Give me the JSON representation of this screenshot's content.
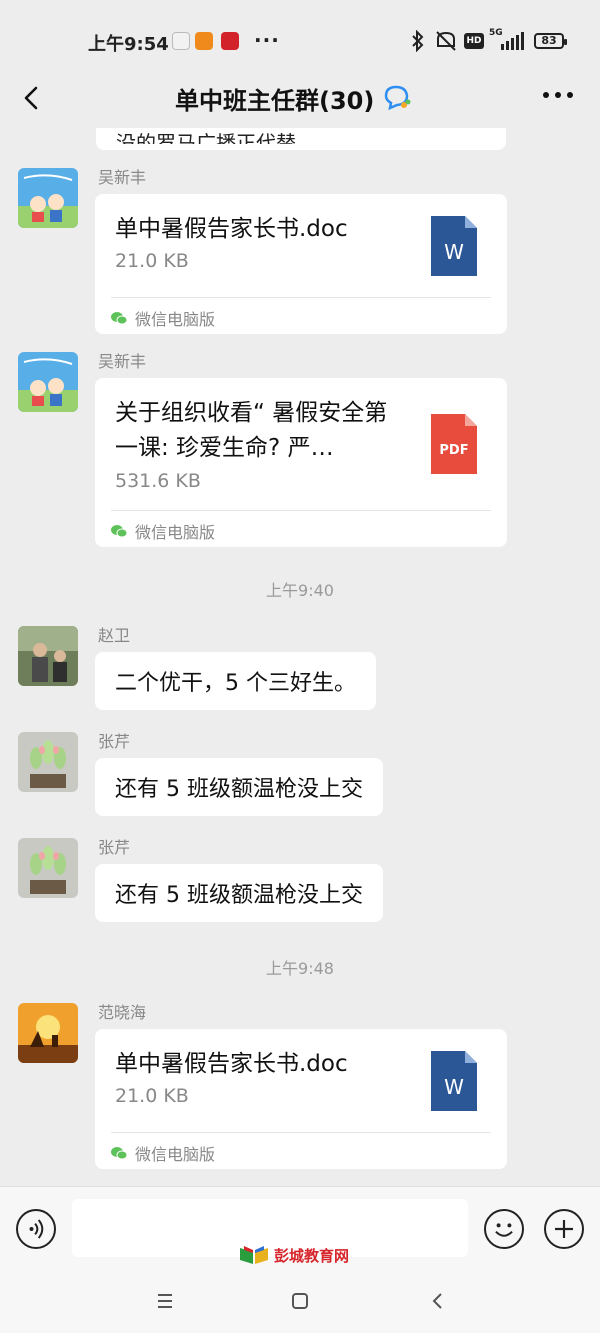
{
  "status_bar": {
    "time": "上午9:54",
    "more_indicator": "···",
    "network": "5G",
    "battery": "83",
    "icons": [
      "bluetooth-icon",
      "mute-icon",
      "hd-icon",
      "signal-icon"
    ]
  },
  "header": {
    "title": "单中班主任群(30)",
    "back_icon": "chevron-left-icon",
    "more_icon": "more-dots-icon"
  },
  "previous_message": {
    "text": "没的罗马广播正代替。"
  },
  "messages": [
    {
      "type": "file",
      "sender": "吴新丰",
      "file_name": "单中暑假告家长书.doc",
      "file_size": "21.0 KB",
      "file_type": "word",
      "file_badge": "W",
      "source": "微信电脑版"
    },
    {
      "type": "file",
      "sender": "吴新丰",
      "file_name": "关于组织收看“ 暑假安全第一课: 珍爱生命? 严…",
      "file_size": "531.6 KB",
      "file_type": "pdf",
      "file_badge": "PDF",
      "source": "微信电脑版"
    },
    {
      "type": "time",
      "text": "上午9:40"
    },
    {
      "type": "text",
      "sender": "赵卫",
      "text": "二个优干，5 个三好生。"
    },
    {
      "type": "text",
      "sender": "张芹",
      "text": "还有 5 班级额温枪没上交"
    },
    {
      "type": "text",
      "sender": "张芹",
      "text": "还有 5 班级额温枪没上交"
    },
    {
      "type": "time",
      "text": "上午9:48"
    },
    {
      "type": "file",
      "sender": "范晓海",
      "file_name": "单中暑假告家长书.doc",
      "file_size": "21.0 KB",
      "file_type": "word",
      "file_badge": "W",
      "source": "微信电脑版"
    }
  ],
  "input_bar": {
    "placeholder": "",
    "voice_icon": "voice-icon",
    "emoji_icon": "emoji-icon",
    "plus_icon": "plus-icon"
  },
  "watermark": "彭城教育网",
  "colors": {
    "background": "#ededed",
    "bubble": "#ffffff",
    "word": "#2b5797",
    "pdf": "#e84c3d",
    "wechat_green": "#5ec25a"
  }
}
